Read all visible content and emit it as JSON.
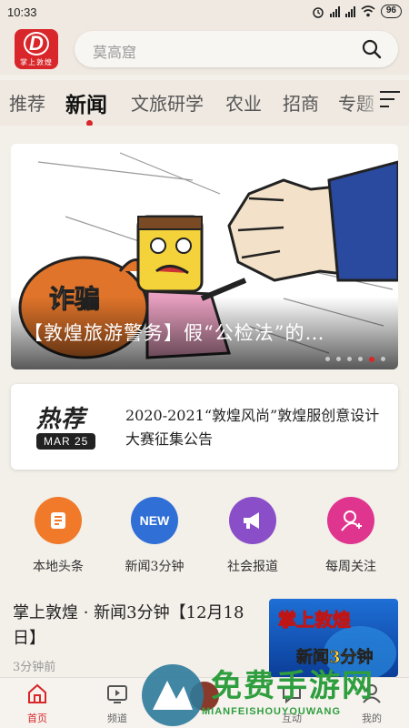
{
  "status_bar": {
    "time": "10:33",
    "battery": "96"
  },
  "header": {
    "logo_text": "掌上敦煌",
    "search_placeholder": "莫高窟"
  },
  "tabs": [
    {
      "label": "推荐"
    },
    {
      "label": "新闻",
      "active": true
    },
    {
      "label": "文旅研学"
    },
    {
      "label": "农业"
    },
    {
      "label": "招商"
    },
    {
      "label": "专题"
    }
  ],
  "banner": {
    "title": "【敦煌旅游警务】假“公检法”的…",
    "image_text": "诈骗",
    "slide_count": 6,
    "active_slide": 5
  },
  "hot": {
    "label": "热荐",
    "date": "MAR 25",
    "title": "2020-2021“敦煌风尚”敦煌服创意设计大赛征集公告"
  },
  "quick": [
    {
      "label": "本地头条",
      "color": "#f07a2a",
      "icon": "document-icon"
    },
    {
      "label": "新闻3分钟",
      "color": "#2f6fd6",
      "icon": "new-badge-icon",
      "icon_text": "NEW"
    },
    {
      "label": "社会报道",
      "color": "#8a4fc8",
      "icon": "megaphone-icon"
    },
    {
      "label": "每周关注",
      "color": "#e0358f",
      "icon": "user-add-icon"
    }
  ],
  "news": {
    "title": "掌上敦煌 · 新闻3分钟【12月18日】",
    "meta": "3分钟前",
    "thumb_line1": "掌上敦煌",
    "thumb_line2": "新闻3分钟"
  },
  "bottom_nav": [
    {
      "label": "首页",
      "icon": "home-icon",
      "active": true
    },
    {
      "label": "频道",
      "icon": "tv-icon"
    },
    {
      "label": "",
      "icon": "center-icon"
    },
    {
      "label": "互动",
      "icon": "chat-icon"
    },
    {
      "label": "我的",
      "icon": "user-icon"
    }
  ],
  "watermark": {
    "title": "免费手游网",
    "subtitle": "MIANFEISHOUYOUWANG"
  },
  "colors": {
    "accent": "#d8262a",
    "background": "#f3efe9"
  }
}
